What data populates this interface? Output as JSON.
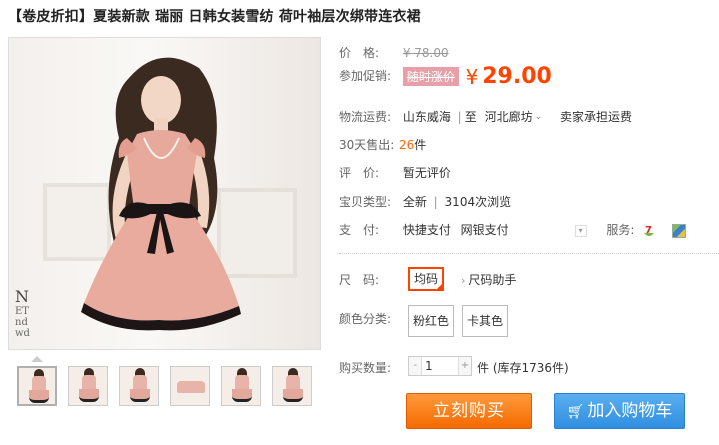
{
  "product": {
    "title": "【卷皮折扣】夏装新款 瑞丽 日韩女装雪纺 荷叶袖层次绑带连衣裙",
    "image_corner_text": [
      "N",
      "ET",
      "nd",
      "wd"
    ]
  },
  "price": {
    "label": "价　格:",
    "original": "¥ 78.00"
  },
  "promo": {
    "label": "参加促销:",
    "tag": "随时涨价",
    "currency": "¥",
    "value": "29.00"
  },
  "shipping": {
    "label": "物流运费:",
    "from": "山东威海",
    "separator": "|",
    "to_prefix": "至",
    "to": "河北廊坊",
    "dropdown_icon": "chevron-down",
    "fee": "卖家承担运费"
  },
  "sales": {
    "label": "30天售出:",
    "count": "26",
    "unit": "件"
  },
  "reviews": {
    "label": "评　价:",
    "value": "暂无评价"
  },
  "item_type": {
    "label": "宝贝类型:",
    "value": "全新",
    "separator": "|",
    "views": "3104次浏览"
  },
  "payment": {
    "label": "支　付:",
    "methods": [
      "快捷支付",
      "网银支付"
    ],
    "service_label": "服务:"
  },
  "size": {
    "label": "尺　码:",
    "selected": "均码",
    "help": "尺码助手"
  },
  "color": {
    "label": "颜色分类:",
    "options": [
      "粉红色",
      "卡其色"
    ]
  },
  "quantity": {
    "label": "购买数量:",
    "minus": "-",
    "value": "1",
    "plus": "+",
    "stock": "件 (库存1736件)"
  },
  "actions": {
    "buy_now": "立刻购买",
    "add_to_cart": "加入购物车"
  },
  "colors": {
    "accent": "#ff4400",
    "buy_button": "#f56a00",
    "cart_button": "#2f8fe0"
  }
}
